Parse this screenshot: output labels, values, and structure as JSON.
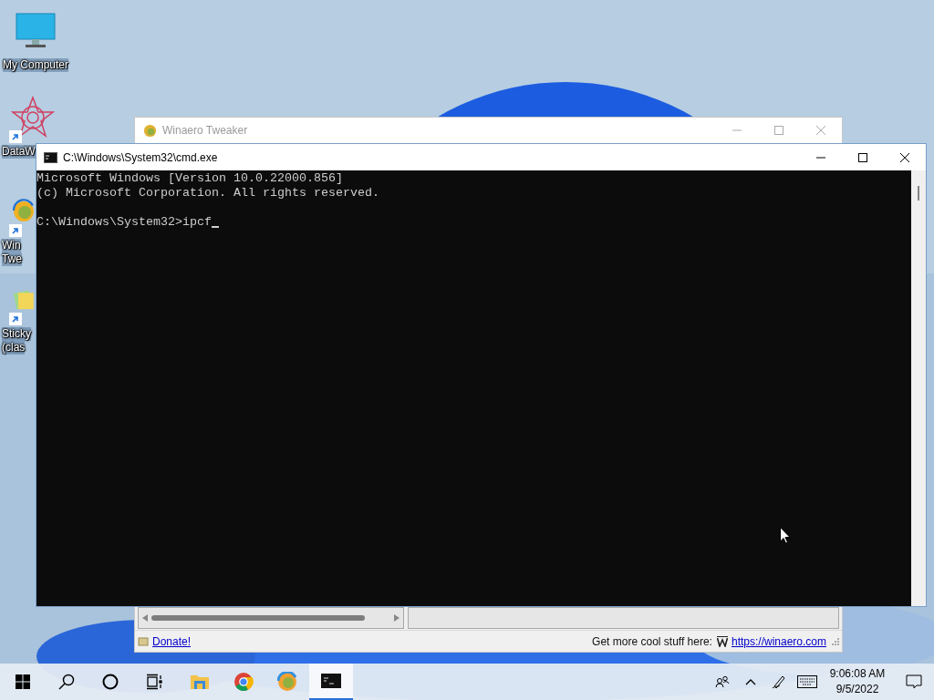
{
  "desktop_icons": [
    {
      "kind": "computer",
      "lines": [
        "My Computer"
      ],
      "shortcut": false
    },
    {
      "kind": "star",
      "lines": [
        "DataW"
      ],
      "shortcut": true
    },
    {
      "kind": "tweaker",
      "lines": [
        "Win",
        "Twe"
      ],
      "shortcut": true
    },
    {
      "kind": "notes",
      "lines": [
        "Sticky",
        "(clas"
      ],
      "shortcut": true
    }
  ],
  "tweaker_window": {
    "title": "Winaero Tweaker",
    "donate_link": "Donate!",
    "promo_text": "Get more cool stuff here:",
    "url_link": "https://winaero.com"
  },
  "cmd_window": {
    "title": "C:\\Windows\\System32\\cmd.exe",
    "lines": [
      "Microsoft Windows [Version 10.0.22000.856]",
      "(c) Microsoft Corporation. All rights reserved."
    ],
    "prompt": "C:\\Windows\\System32>ipcf"
  },
  "taskbar": {
    "apps": [
      {
        "kind": "start",
        "selected": false
      },
      {
        "kind": "search",
        "selected": false
      },
      {
        "kind": "cortana",
        "selected": false
      },
      {
        "kind": "taskview",
        "selected": false
      },
      {
        "kind": "explorer",
        "selected": false
      },
      {
        "kind": "chrome",
        "selected": false
      },
      {
        "kind": "tweaker",
        "selected": false
      },
      {
        "kind": "cmd",
        "selected": true
      }
    ],
    "tray": [
      {
        "kind": "people"
      },
      {
        "kind": "caret"
      },
      {
        "kind": "pen"
      },
      {
        "kind": "keyboard"
      }
    ],
    "time": "9:06:08 AM",
    "date": "9/5/2022"
  }
}
